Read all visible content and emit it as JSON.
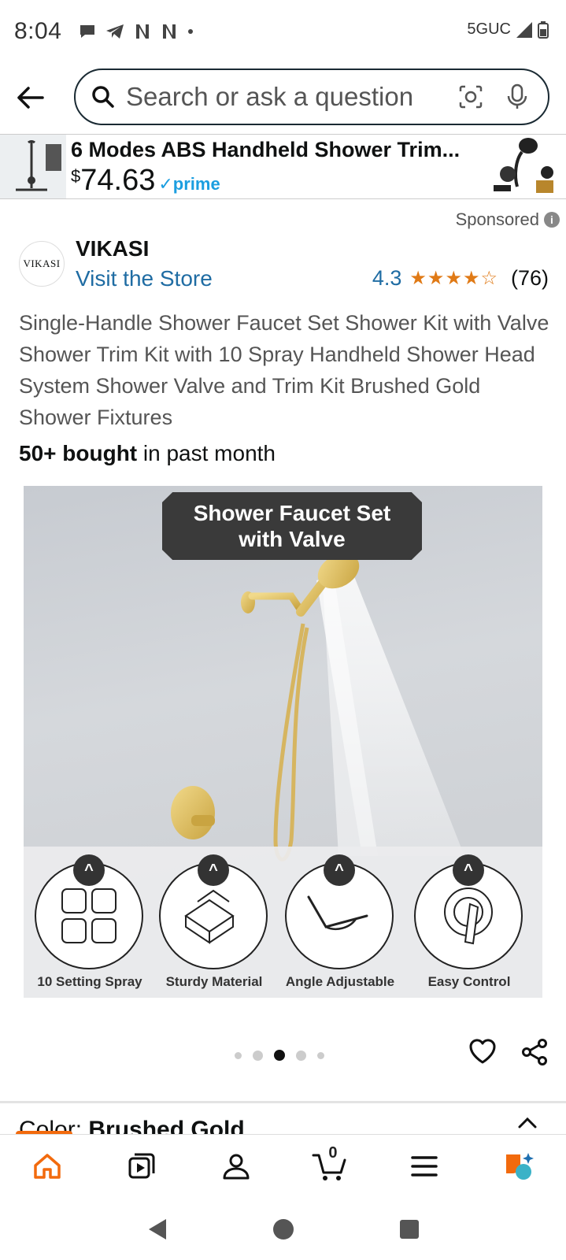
{
  "status": {
    "time": "8:04",
    "network": "5GUC"
  },
  "search": {
    "placeholder": "Search or ask a question"
  },
  "banner": {
    "title": "6 Modes ABS Handheld Shower Trim...",
    "price_symbol": "$",
    "price": "74.63",
    "prime_label": "prime"
  },
  "sponsored_label": "Sponsored",
  "brand": {
    "logo_text": "VIKASI",
    "name": "VIKASI",
    "visit_store": "Visit the Store"
  },
  "rating": {
    "value": "4.3",
    "stars": 4.3,
    "count": "(76)"
  },
  "product": {
    "title": "Single-Handle Shower Faucet Set Shower Kit with Valve Shower Trim Kit with 10 Spray Handheld Shower Head System Shower Valve and Trim Kit Brushed Gold Shower Fixtures",
    "bought_bold": "50+ bought",
    "bought_rest": " in past month"
  },
  "image": {
    "caption_line1": "Shower Faucet Set",
    "caption_line2": "with Valve",
    "features": [
      {
        "label": "10 Setting Spray",
        "icon": "grid-icon"
      },
      {
        "label": "Sturdy Material",
        "icon": "blocks-icon"
      },
      {
        "label": "Angle Adjustable",
        "icon": "angle-icon"
      },
      {
        "label": "Easy Control",
        "icon": "handle-icon"
      }
    ],
    "chevron": "^"
  },
  "carousel": {
    "total": 5,
    "active_index": 2
  },
  "color_section": {
    "label": "Color: ",
    "value": "Brushed Gold"
  },
  "bottom_nav": {
    "cart_count": "0",
    "items": [
      "home-icon",
      "video-icon",
      "account-icon",
      "cart-icon",
      "menu-icon",
      "rufus-icon"
    ]
  },
  "colors": {
    "accent": "#f26a0d",
    "link": "#1f6ca3",
    "star": "#e07a16",
    "prime": "#1b9ee0"
  }
}
